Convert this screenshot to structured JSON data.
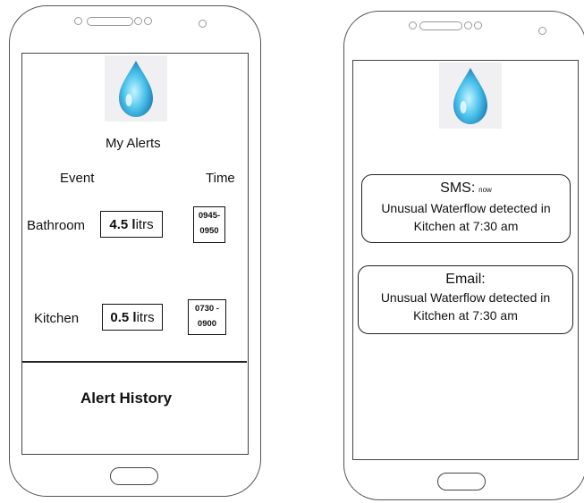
{
  "screen1": {
    "title": "My Alerts",
    "headers": {
      "event": "Event",
      "time": "Time"
    },
    "rows": [
      {
        "event": "Bathroom",
        "value": "4.5",
        "unit": "litrs",
        "time_line1": "0945-",
        "time_line2": "0950"
      },
      {
        "event": "Kitchen",
        "value": "0.5",
        "unit": "litrs",
        "time_line1": "0730 -",
        "time_line2": "0900"
      }
    ],
    "footer_button": "Alert History",
    "icon": "water-drop-icon"
  },
  "screen2": {
    "icon": "water-drop-icon",
    "notifications": [
      {
        "channel": "SMS:",
        "badge": "now",
        "line1": "Unusual Waterflow detected in",
        "line2": "Kitchen at 7:30 am"
      },
      {
        "channel": "Email:",
        "badge": "",
        "line1": "Unusual Waterflow detected in",
        "line2": "Kitchen at 7:30 am"
      }
    ]
  },
  "colors": {
    "drop_light": "#8fe3f7",
    "drop_dark": "#1479b8",
    "icon_bg": "#f0f0f2"
  }
}
